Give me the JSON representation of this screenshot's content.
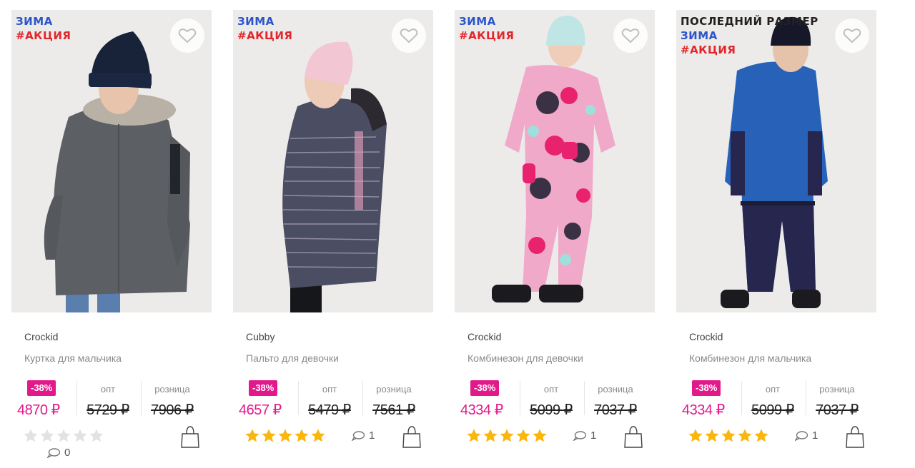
{
  "colors": {
    "accent": "#e2198a",
    "season": "#2b55c9",
    "promo": "#e3262b",
    "star_on": "#f9b60c",
    "star_off": "#e2e2e2"
  },
  "columns": {
    "opt_label": "опт",
    "retail_label": "розница"
  },
  "products": [
    {
      "tags": {
        "season": "ЗИМА",
        "promo": "#АКЦИЯ"
      },
      "brand": "Crockid",
      "title": "Куртка для мальчика",
      "discount": "-38%",
      "price_now": "4870 ₽",
      "price_opt": "5729 ₽",
      "price_retail": "7906 ₽",
      "rating": 0,
      "comments": "0",
      "image": "boy in dark gray parka with fur hood and navy hat"
    },
    {
      "tags": {
        "season": "ЗИМА",
        "promo": "#АКЦИЯ"
      },
      "brand": "Cubby",
      "title": "Пальто для девочки",
      "discount": "-38%",
      "price_now": "4657 ₽",
      "price_opt": "5479 ₽",
      "price_retail": "7561 ₽",
      "rating": 5,
      "comments": "1",
      "image": "girl in striped long coat with pink hat"
    },
    {
      "tags": {
        "season": "ЗИМА",
        "promo": "#АКЦИЯ"
      },
      "brand": "Crockid",
      "title": "Комбинезон для девочки",
      "discount": "-38%",
      "price_now": "4334 ₽",
      "price_opt": "5099 ₽",
      "price_retail": "7037 ₽",
      "rating": 5,
      "comments": "1",
      "image": "girl in pink patterned snowsuit"
    },
    {
      "tags": {
        "last": "ПОСЛЕДНИЙ РАЗМЕР",
        "season": "ЗИМА",
        "promo": "#АКЦИЯ"
      },
      "brand": "Crockid",
      "title": "Комбинезон для мальчика",
      "discount": "-38%",
      "price_now": "4334 ₽",
      "price_opt": "5099 ₽",
      "price_retail": "7037 ₽",
      "rating": 5,
      "comments": "1",
      "image": "boy in blue and navy snowsuit"
    }
  ]
}
